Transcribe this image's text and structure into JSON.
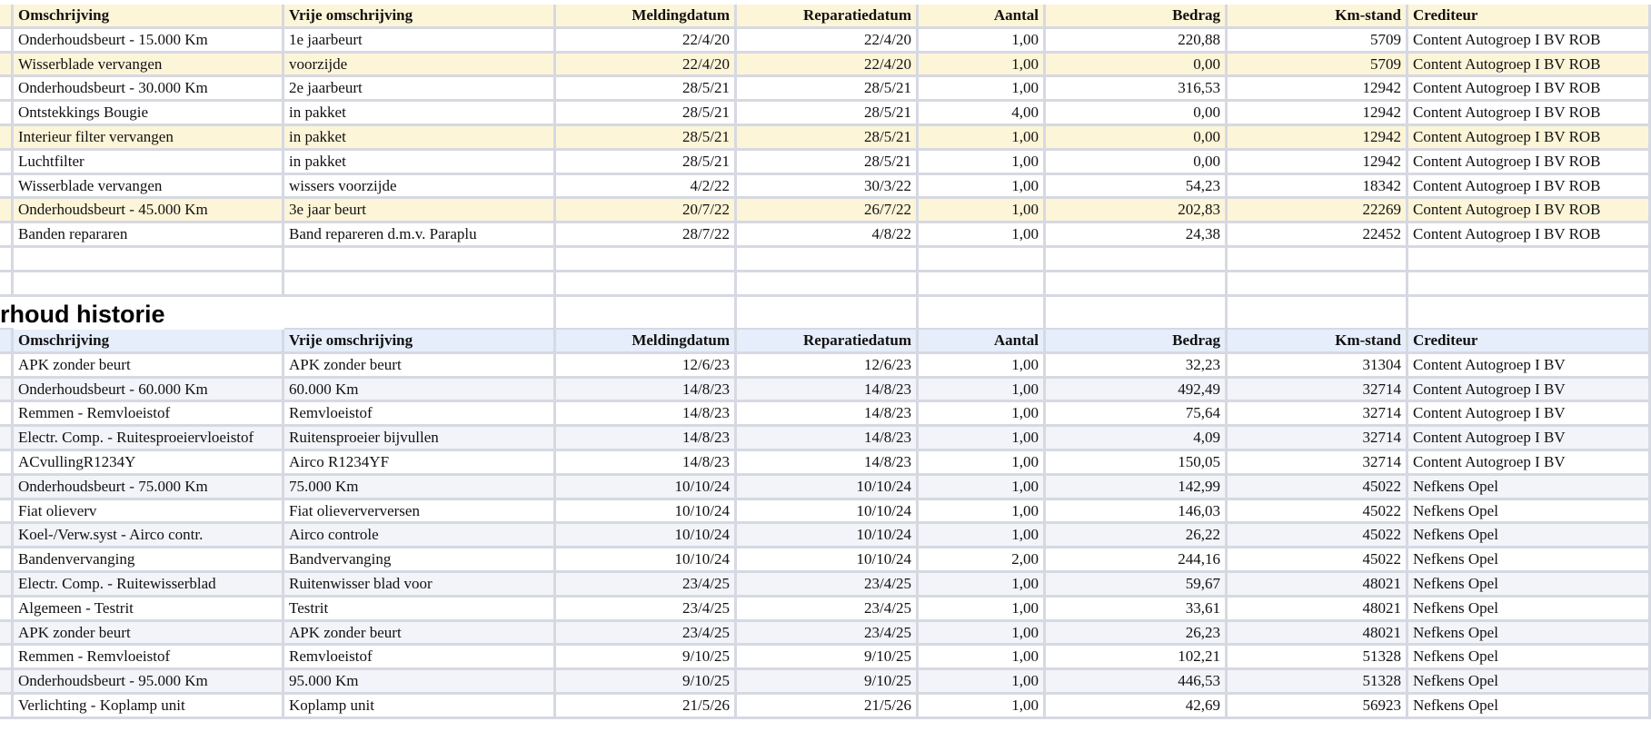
{
  "columns": [
    "Omschrijving",
    "Vrije omschrijving",
    "Meldingdatum",
    "Reparatiedatum",
    "Aantal",
    "Bedrag",
    "Km-stand",
    "Crediteur"
  ],
  "table1": {
    "rows": [
      [
        "Onderhoudsbeurt - 15.000 Km",
        "1e jaarbeurt",
        "22/4/20",
        "22/4/20",
        "1,00",
        "220,88",
        "5709",
        "Content Autogroep I BV ROB"
      ],
      [
        "Wisserblade vervangen",
        "voorzijde",
        "22/4/20",
        "22/4/20",
        "1,00",
        "0,00",
        "5709",
        "Content Autogroep I BV ROB"
      ],
      [
        "Onderhoudsbeurt - 30.000 Km",
        "2e jaarbeurt",
        "28/5/21",
        "28/5/21",
        "1,00",
        "316,53",
        "12942",
        "Content Autogroep I BV ROB"
      ],
      [
        "Ontstekkings Bougie",
        "in pakket",
        "28/5/21",
        "28/5/21",
        "4,00",
        "0,00",
        "12942",
        "Content Autogroep I BV ROB"
      ],
      [
        "Interieur filter vervangen",
        "in pakket",
        "28/5/21",
        "28/5/21",
        "1,00",
        "0,00",
        "12942",
        "Content Autogroep I BV ROB"
      ],
      [
        "Luchtfilter",
        "in pakket",
        "28/5/21",
        "28/5/21",
        "1,00",
        "0,00",
        "12942",
        "Content Autogroep I BV ROB"
      ],
      [
        "Wisserblade vervangen",
        "wissers voorzijde",
        "4/2/22",
        "30/3/22",
        "1,00",
        "54,23",
        "18342",
        "Content Autogroep I BV ROB"
      ],
      [
        "Onderhoudsbeurt - 45.000 Km",
        "3e jaar beurt",
        "20/7/22",
        "26/7/22",
        "1,00",
        "202,83",
        "22269",
        "Content Autogroep I BV ROB"
      ],
      [
        "Banden repararen",
        "Band repareren d.m.v. Paraplu",
        "28/7/22",
        "4/8/22",
        "1,00",
        "24,38",
        "22452",
        "Content Autogroep I BV ROB"
      ]
    ]
  },
  "section_title": "rhoud historie",
  "table2": {
    "rows": [
      [
        "APK zonder beurt",
        "APK zonder beurt",
        "12/6/23",
        "12/6/23",
        "1,00",
        "32,23",
        "31304",
        "Content Autogroep I BV"
      ],
      [
        "Onderhoudsbeurt - 60.000 Km",
        "60.000 Km",
        "14/8/23",
        "14/8/23",
        "1,00",
        "492,49",
        "32714",
        "Content Autogroep I BV"
      ],
      [
        "Remmen - Remvloeistof",
        "Remvloeistof",
        "14/8/23",
        "14/8/23",
        "1,00",
        "75,64",
        "32714",
        "Content Autogroep I BV"
      ],
      [
        "Electr. Comp. - Ruitesproeiervloeistof",
        "Ruitensproeier bijvullen",
        "14/8/23",
        "14/8/23",
        "1,00",
        "4,09",
        "32714",
        "Content Autogroep I BV"
      ],
      [
        "ACvullingR1234Y",
        "Airco R1234YF",
        "14/8/23",
        "14/8/23",
        "1,00",
        "150,05",
        "32714",
        "Content Autogroep I BV"
      ],
      [
        "Onderhoudsbeurt - 75.000 Km",
        "75.000 Km",
        "10/10/24",
        "10/10/24",
        "1,00",
        "142,99",
        "45022",
        "Nefkens Opel"
      ],
      [
        "Fiat olieverv",
        "Fiat olieververversen",
        "10/10/24",
        "10/10/24",
        "1,00",
        "146,03",
        "45022",
        "Nefkens Opel"
      ],
      [
        "Koel-/Verw.syst - Airco contr.",
        "Airco controle",
        "10/10/24",
        "10/10/24",
        "1,00",
        "26,22",
        "45022",
        "Nefkens Opel"
      ],
      [
        "Bandenvervanging",
        "Bandvervanging",
        "10/10/24",
        "10/10/24",
        "2,00",
        "244,16",
        "45022",
        "Nefkens Opel"
      ],
      [
        "Electr. Comp. - Ruitewisserblad",
        "Ruitenwisser blad voor",
        "23/4/25",
        "23/4/25",
        "1,00",
        "59,67",
        "48021",
        "Nefkens Opel"
      ],
      [
        "Algemeen - Testrit",
        "Testrit",
        "23/4/25",
        "23/4/25",
        "1,00",
        "33,61",
        "48021",
        "Nefkens Opel"
      ],
      [
        "APK zonder beurt",
        "APK zonder beurt",
        "23/4/25",
        "23/4/25",
        "1,00",
        "26,23",
        "48021",
        "Nefkens Opel"
      ],
      [
        "Remmen - Remvloeistof",
        "Remvloeistof",
        "9/10/25",
        "9/10/25",
        "1,00",
        "102,21",
        "51328",
        "Nefkens Opel"
      ],
      [
        "Onderhoudsbeurt - 95.000 Km",
        "95.000 Km",
        "9/10/25",
        "9/10/25",
        "1,00",
        "446,53",
        "51328",
        "Nefkens Opel"
      ],
      [
        "Verlichting - Koplamp unit",
        "Koplamp unit",
        "21/5/26",
        "21/5/26",
        "1,00",
        "42,69",
        "56923",
        "Nefkens Opel"
      ]
    ]
  },
  "colors": {
    "header_yellow": "#fdf5d8",
    "header_blue": "#e6eefb",
    "band_blue": "#f2f4f9",
    "gridline": "#d6d9e2"
  }
}
